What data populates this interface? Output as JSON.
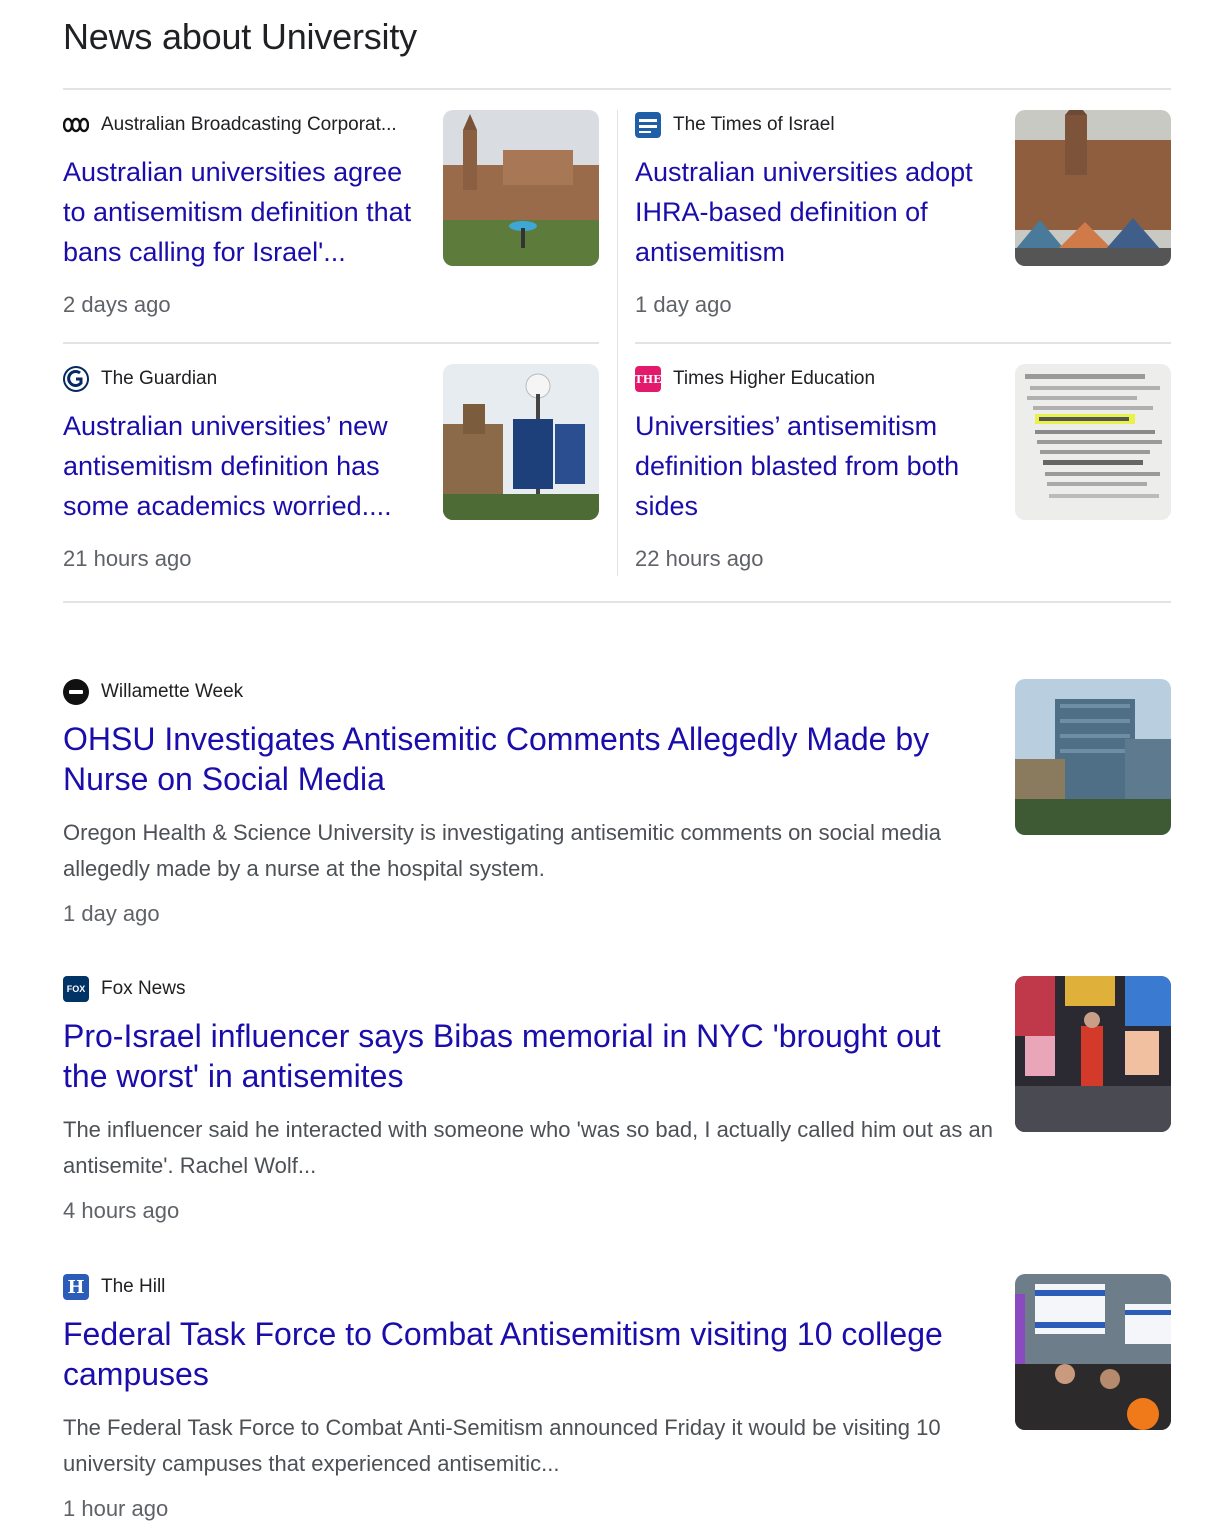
{
  "section_title": "News about University",
  "top_stories": [
    {
      "source": "Australian Broadcasting Corporat...",
      "favicon": "abc-logo-icon",
      "title": "Australian universities agree to antisemitism definition that bans calling for Israel'...",
      "time": "2 days ago",
      "thumbnail": "sandstone-university-building-image"
    },
    {
      "source": "The Times of Israel",
      "favicon": "times-of-israel-icon",
      "title": "Australian universities adopt IHRA-based definition of antisemitism",
      "time": "1 day ago",
      "thumbnail": "university-protest-tents-image"
    },
    {
      "source": "The Guardian",
      "favicon": "guardian-icon",
      "title": "Australian universities’ new antisemitism definition has some academics worried....",
      "time": "21 hours ago",
      "thumbnail": "campus-banner-lamp-image"
    },
    {
      "source": "Times Higher Education",
      "favicon": "the-icon",
      "title": "Universities’ antisemitism definition blasted from both sides",
      "time": "22 hours ago",
      "thumbnail": "dictionary-definition-image"
    }
  ],
  "stories": [
    {
      "source": "Willamette Week",
      "favicon": "willamette-week-icon",
      "title": "OHSU Investigates Antisemitic Comments Allegedly Made by Nurse on Social Media",
      "snippet": "Oregon Health & Science University is investigating antisemitic comments on social media allegedly made by a nurse at the hospital system.",
      "time": "1 day ago",
      "thumbnail": "hospital-building-image"
    },
    {
      "source": "Fox News",
      "favicon": "fox-news-icon",
      "title": "Pro-Israel influencer says Bibas memorial in NYC 'brought out the worst' in antisemites",
      "snippet": "The influencer said he interacted with someone who 'was so bad, I actually called him out as an antisemite'. Rachel Wolf...",
      "time": "4 hours ago",
      "thumbnail": "times-square-memorial-image"
    },
    {
      "source": "The Hill",
      "favicon": "the-hill-icon",
      "title": "Federal Task Force to Combat Antisemitism visiting 10 college campuses",
      "snippet": "The Federal Task Force to Combat Anti-Semitism announced Friday it would be visiting 10 university campuses that experienced antisemitic...",
      "time": "1 hour ago",
      "thumbnail": "israeli-flag-rally-image"
    }
  ],
  "favicon_text": {
    "fox": "FOX",
    "hill": "H",
    "the": "THE"
  },
  "colors": {
    "link": "#1a0dab",
    "meta": "#5f6368",
    "snippet": "#4d5156",
    "divider": "#e3e3e3"
  }
}
